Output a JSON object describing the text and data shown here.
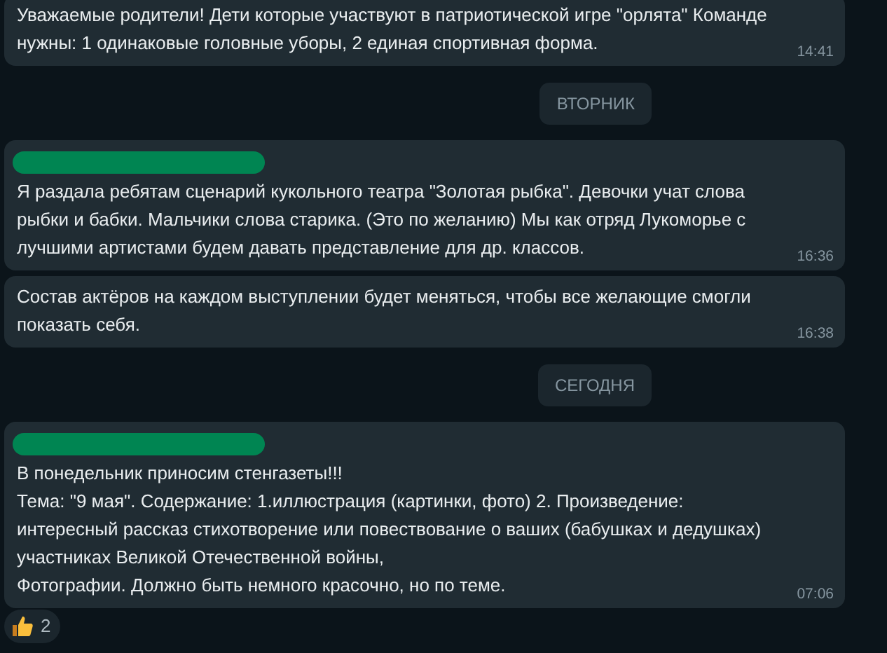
{
  "items": [
    {
      "kind": "message",
      "redacted_sender": false,
      "lines": [
        "Уважаемые родители! Дети которые участвуют в патриотической игре \"орлята\" Команде",
        "нужны:  1 одинаковые головные уборы, 2 единая спортивная форма."
      ],
      "time": "14:41"
    },
    {
      "kind": "date",
      "label": "ВТОРНИК"
    },
    {
      "kind": "message",
      "redacted_sender": true,
      "lines": [
        "Я раздала ребятам сценарий кукольного театра \"Золотая рыбка\". Девочки учат слова",
        "рыбки и бабки. Мальчики слова старика. (Это по желанию) Мы как отряд Лукоморье с",
        "лучшими артистами будем давать  представление для др. классов."
      ],
      "time": "16:36"
    },
    {
      "kind": "message",
      "redacted_sender": false,
      "lines": [
        "Состав актёров на каждом выступлении будет меняться, чтобы все желающие смогли",
        "показать себя."
      ],
      "time": "16:38"
    },
    {
      "kind": "date",
      "label": "СЕГОДНЯ"
    },
    {
      "kind": "message",
      "redacted_sender": true,
      "lines": [
        "В понедельник приносим стенгазеты!!!",
        "Тема: \"9 мая\". Содержание: 1.иллюстрация (картинки, фото) 2. Произведение:",
        "интересный рассказ стихотворение или повествование о ваших (бабушках и дедушках)",
        "участниках Великой Отечественной войны,",
        "Фотографии. Должно быть немного красочно, но по теме."
      ],
      "time": "07:06",
      "reaction": {
        "count": "2"
      }
    }
  ]
}
